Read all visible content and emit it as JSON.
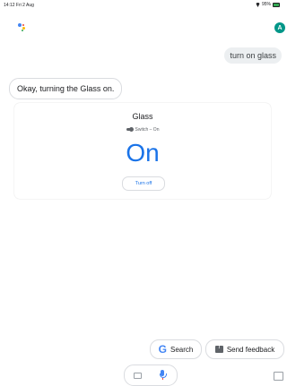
{
  "status_bar": {
    "time": "14:12  Fri 2 Aug",
    "battery": "95%"
  },
  "header": {
    "avatar_letter": "A"
  },
  "conversation": {
    "user_message": "turn on glass",
    "assistant_message": "Okay, turning the Glass on."
  },
  "device_card": {
    "name": "Glass",
    "type": "Switch – On",
    "state": "On",
    "action": "Turn off"
  },
  "suggestions": {
    "search": "Search",
    "feedback": "Send feedback"
  },
  "colors": {
    "accent": "#1a73e8",
    "avatar": "#009688"
  }
}
